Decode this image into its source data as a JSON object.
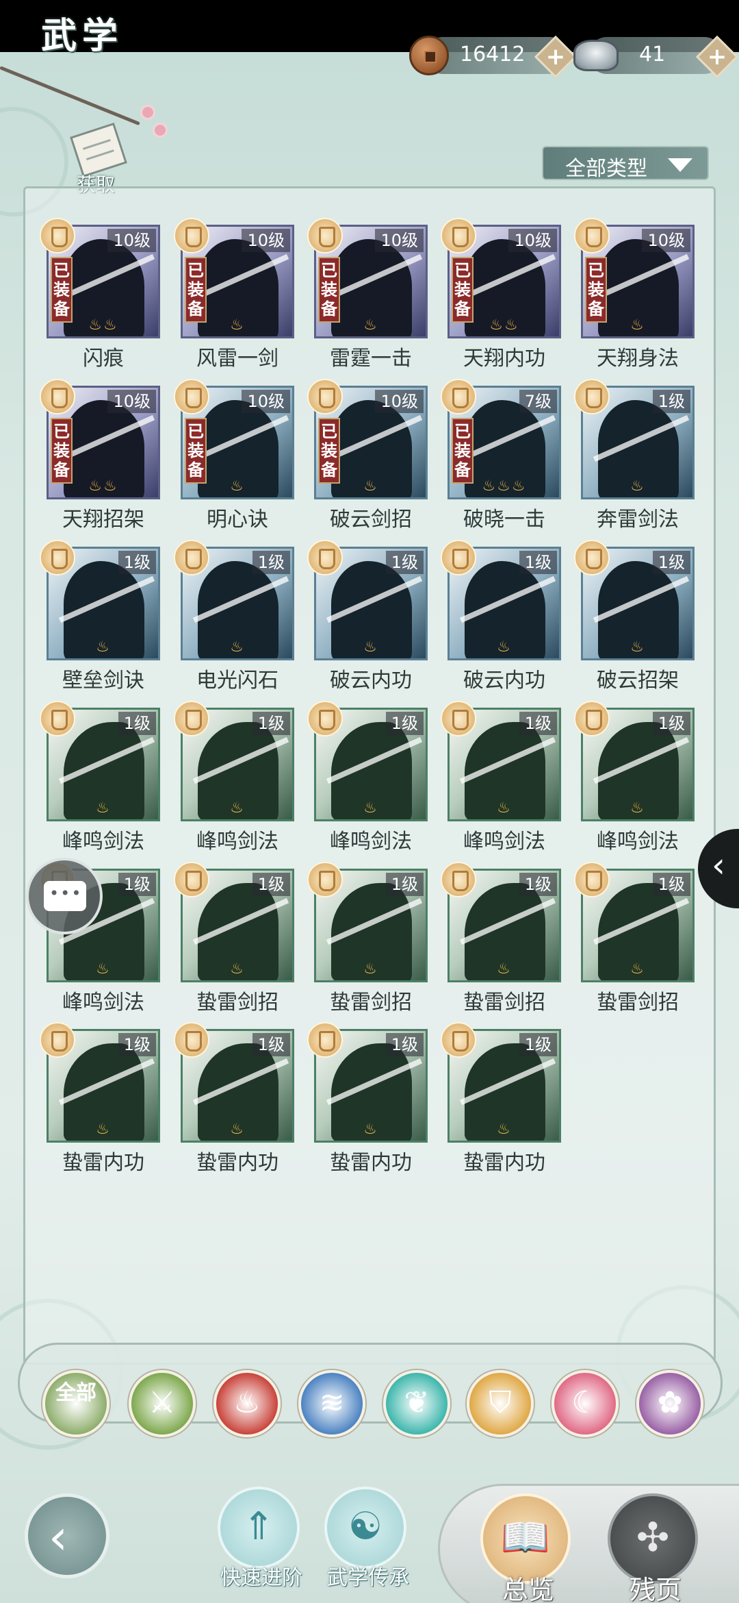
{
  "header": {
    "title": "武学",
    "copper": "16412",
    "silver": "41",
    "plus_label": "+"
  },
  "acquire": {
    "label": "获取"
  },
  "filter": {
    "label": "全部类型"
  },
  "level_labels": {
    "lv10": "10级",
    "lv7": "7级",
    "lv1": "1级"
  },
  "equipped_label": "已装备",
  "skills": [
    {
      "name": "闪痕",
      "level": "10级",
      "equipped": true,
      "theme": "purple",
      "flames": "♨♨"
    },
    {
      "name": "风雷一剑",
      "level": "10级",
      "equipped": true,
      "theme": "purple",
      "flames": "♨"
    },
    {
      "name": "雷霆一击",
      "level": "10级",
      "equipped": true,
      "theme": "purple",
      "flames": "♨"
    },
    {
      "name": "天翔内功",
      "level": "10级",
      "equipped": true,
      "theme": "purple",
      "flames": "♨♨"
    },
    {
      "name": "天翔身法",
      "level": "10级",
      "equipped": true,
      "theme": "purple",
      "flames": "♨"
    },
    {
      "name": "天翔招架",
      "level": "10级",
      "equipped": true,
      "theme": "purple",
      "flames": "♨♨"
    },
    {
      "name": "明心诀",
      "level": "10级",
      "equipped": true,
      "theme": "blue",
      "flames": "♨"
    },
    {
      "name": "破云剑招",
      "level": "10级",
      "equipped": true,
      "theme": "blue",
      "flames": "♨"
    },
    {
      "name": "破晓一击",
      "level": "7级",
      "equipped": true,
      "theme": "blue",
      "flames": "♨♨♨"
    },
    {
      "name": "奔雷剑法",
      "level": "1级",
      "equipped": false,
      "theme": "blue",
      "flames": "♨"
    },
    {
      "name": "壁垒剑诀",
      "level": "1级",
      "equipped": false,
      "theme": "blue",
      "flames": "♨"
    },
    {
      "name": "电光闪石",
      "level": "1级",
      "equipped": false,
      "theme": "blue",
      "flames": "♨"
    },
    {
      "name": "破云内功",
      "level": "1级",
      "equipped": false,
      "theme": "blue",
      "flames": "♨"
    },
    {
      "name": "破云内功",
      "level": "1级",
      "equipped": false,
      "theme": "blue",
      "flames": "♨"
    },
    {
      "name": "破云招架",
      "level": "1级",
      "equipped": false,
      "theme": "blue",
      "flames": "♨"
    },
    {
      "name": "峰鸣剑法",
      "level": "1级",
      "equipped": false,
      "theme": "green",
      "flames": "♨"
    },
    {
      "name": "峰鸣剑法",
      "level": "1级",
      "equipped": false,
      "theme": "green",
      "flames": "♨"
    },
    {
      "name": "峰鸣剑法",
      "level": "1级",
      "equipped": false,
      "theme": "green",
      "flames": "♨"
    },
    {
      "name": "峰鸣剑法",
      "level": "1级",
      "equipped": false,
      "theme": "green",
      "flames": "♨"
    },
    {
      "name": "峰鸣剑法",
      "level": "1级",
      "equipped": false,
      "theme": "green",
      "flames": "♨"
    },
    {
      "name": "峰鸣剑法",
      "level": "1级",
      "equipped": false,
      "theme": "green",
      "flames": "♨"
    },
    {
      "name": "蛰雷剑招",
      "level": "1级",
      "equipped": false,
      "theme": "green",
      "flames": "♨"
    },
    {
      "name": "蛰雷剑招",
      "level": "1级",
      "equipped": false,
      "theme": "green",
      "flames": "♨"
    },
    {
      "name": "蛰雷剑招",
      "level": "1级",
      "equipped": false,
      "theme": "green",
      "flames": "♨"
    },
    {
      "name": "蛰雷剑招",
      "level": "1级",
      "equipped": false,
      "theme": "green",
      "flames": "♨"
    },
    {
      "name": "蛰雷内功",
      "level": "1级",
      "equipped": false,
      "theme": "green",
      "flames": "♨"
    },
    {
      "name": "蛰雷内功",
      "level": "1级",
      "equipped": false,
      "theme": "green",
      "flames": "♨"
    },
    {
      "name": "蛰雷内功",
      "level": "1级",
      "equipped": false,
      "theme": "green",
      "flames": "♨"
    },
    {
      "name": "蛰雷内功",
      "level": "1级",
      "equipped": false,
      "theme": "green",
      "flames": "♨"
    }
  ],
  "categories": [
    {
      "id": "all",
      "label": "全部",
      "icon": "all-icon",
      "color": "#8fae6d"
    },
    {
      "id": "sword",
      "label": "",
      "icon": "sword-icon",
      "color": "#7fa94f",
      "glyph": "⚔"
    },
    {
      "id": "fire",
      "label": "",
      "icon": "flame-icon",
      "color": "#c9453c",
      "glyph": "♨"
    },
    {
      "id": "wave",
      "label": "",
      "icon": "wave-icon",
      "color": "#4d84c2",
      "glyph": "≋"
    },
    {
      "id": "butterfly",
      "label": "",
      "icon": "butterfly-icon",
      "color": "#3fb7ad",
      "glyph": "❦"
    },
    {
      "id": "shield",
      "label": "",
      "icon": "shield-icon",
      "color": "#e0a947",
      "glyph": "⛉"
    },
    {
      "id": "moon",
      "label": "",
      "icon": "moon-icon",
      "color": "#e06b87",
      "glyph": "☾"
    },
    {
      "id": "rose",
      "label": "",
      "icon": "rose-icon",
      "color": "#9a63a6",
      "glyph": "✿"
    }
  ],
  "bottom": {
    "back_icon": "back-icon",
    "fast_advance": "快速进阶",
    "inherit": "武学传承",
    "overview": "总览",
    "fragments": "残页"
  }
}
